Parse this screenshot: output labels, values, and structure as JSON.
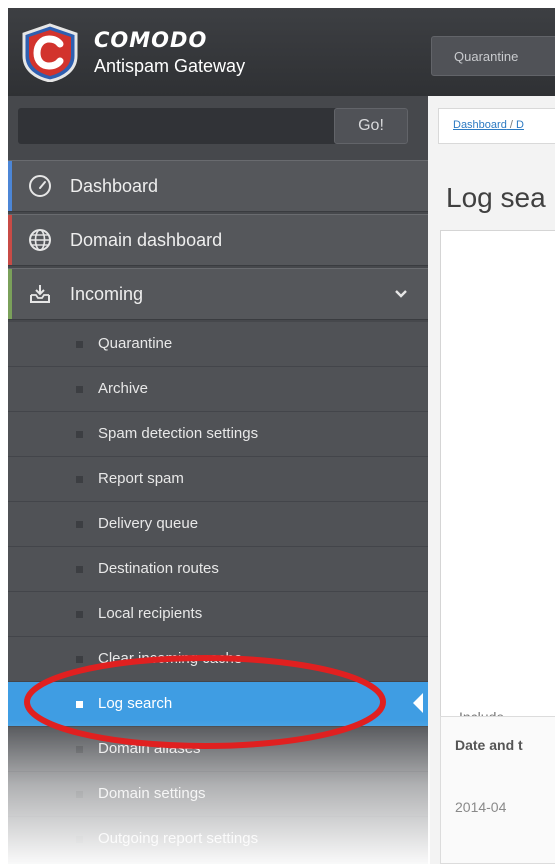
{
  "header": {
    "brand_name": "COMODO",
    "product_name": "Antispam Gateway",
    "quarantine_button": "Quarantine"
  },
  "search": {
    "go_label": "Go!"
  },
  "nav": {
    "dashboard": "Dashboard",
    "domain_dashboard": "Domain dashboard",
    "incoming": "Incoming",
    "submenu": [
      "Quarantine",
      "Archive",
      "Spam detection settings",
      "Report spam",
      "Delivery queue",
      "Destination routes",
      "Local recipients",
      "Clear incoming cache",
      "Log search",
      "Domain aliases",
      "Domain settings",
      "Outgoing report settings"
    ],
    "active_item": "Log search"
  },
  "content": {
    "breadcrumb_link": "Dashboard",
    "breadcrumb_rest": "D",
    "page_title": "Log sea",
    "include_label": "Include",
    "table_header": "Date and t",
    "first_row_date": "2014-04"
  },
  "colors": {
    "nav_accent_dashboard": "#4c86d6",
    "nav_accent_domain": "#c84b46",
    "nav_accent_incoming": "#7aa05a",
    "active_item": "#3f9de3",
    "highlight_ellipse": "#e02020"
  }
}
